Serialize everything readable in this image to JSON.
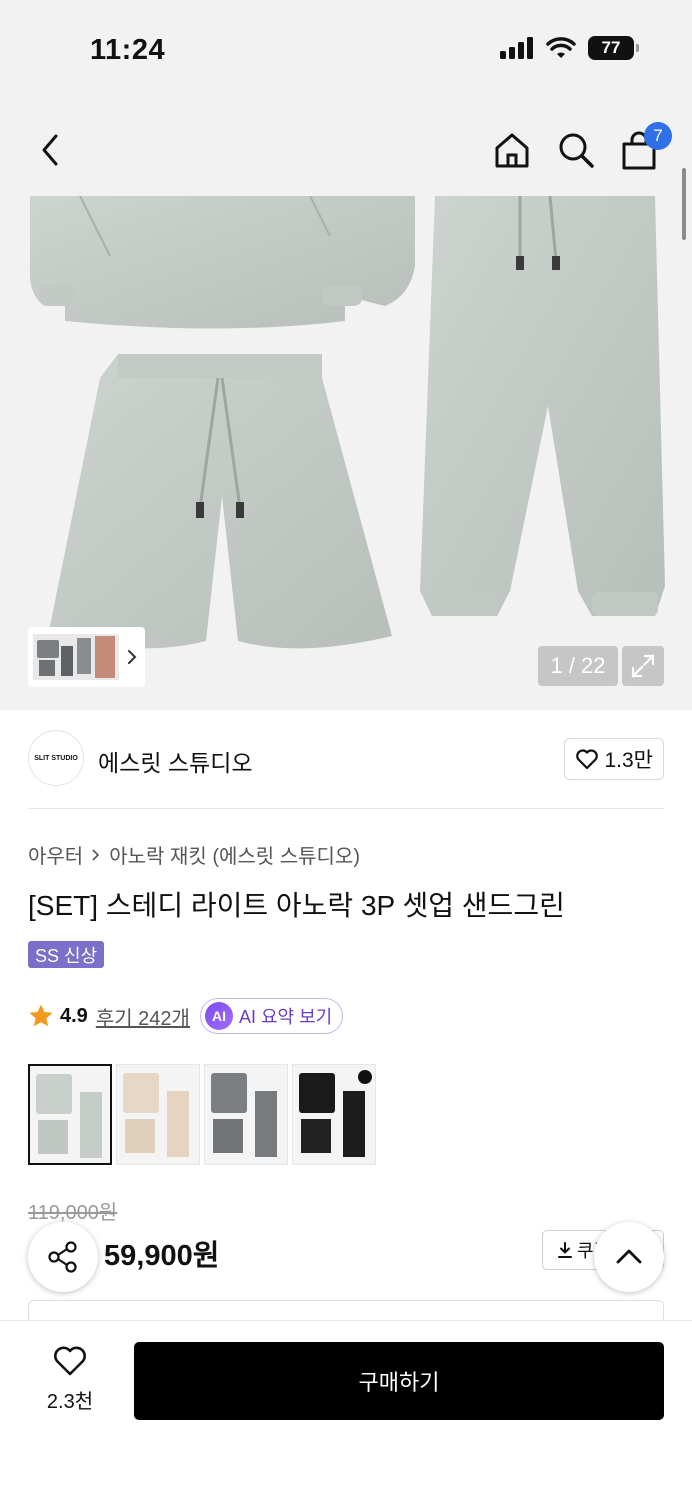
{
  "status_bar": {
    "time": "11:24",
    "battery": "77"
  },
  "header": {
    "cart_count": "7"
  },
  "gallery": {
    "counter": "1 / 22"
  },
  "brand": {
    "name": "에스릿 스튜디오",
    "logo_text": "SLIT STUDIO",
    "likes": "1.3만"
  },
  "breadcrumb": {
    "category": "아우터",
    "subcategory": "아노락 재킷 (에스릿 스튜디오)"
  },
  "product": {
    "title": "[SET] 스테디 라이트 아노락 3P 셋업 샌드그린",
    "tag": "SS 신상",
    "rating": "4.9",
    "review_label": "후기 242개",
    "ai_badge": "AI",
    "ai_label": "AI 요약 보기",
    "original_price": "119,000원",
    "sale_price": "59,900원",
    "coupon_label": "쿠폰"
  },
  "variants": [
    {
      "name": "sand-green",
      "color": "#c9cfcb"
    },
    {
      "name": "beige",
      "color": "#e6d7c6"
    },
    {
      "name": "gray",
      "color": "#7c7f82"
    },
    {
      "name": "black",
      "color": "#1a1a1a"
    }
  ],
  "bottom_bar": {
    "wish_count": "2.3천",
    "buy_label": "구매하기"
  },
  "colors": {
    "accent": "#2f6fe8",
    "tag": "#7a6fc9",
    "ai": "#6a3dc8",
    "star": "#f29a1c"
  }
}
